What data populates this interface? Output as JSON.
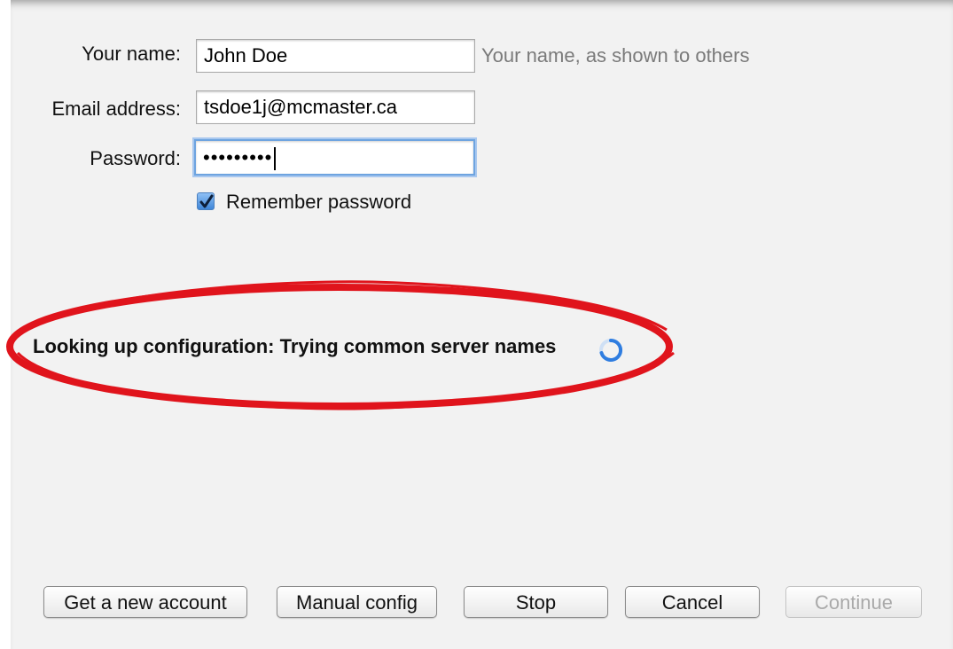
{
  "form": {
    "name_label": "Your name:",
    "name_value": "John Doe",
    "name_hint": "Your name, as shown to others",
    "email_label": "Email address:",
    "email_value": "tsdoe1j@mcmaster.ca",
    "password_label": "Password:",
    "password_value": "•••••••••",
    "remember_label": "Remember password",
    "remember_checked": true
  },
  "status": {
    "text": "Looking up configuration: Trying common server names"
  },
  "buttons": {
    "new_account": "Get a new account",
    "manual_config": "Manual config",
    "stop": "Stop",
    "cancel": "Cancel",
    "continue": "Continue"
  },
  "colors": {
    "focus_ring": "#6ea4e0",
    "annotation": "#e0141c",
    "spinner": "#2f7de0"
  },
  "icons": [
    "checkbox-check-icon",
    "loading-spinner-icon"
  ]
}
